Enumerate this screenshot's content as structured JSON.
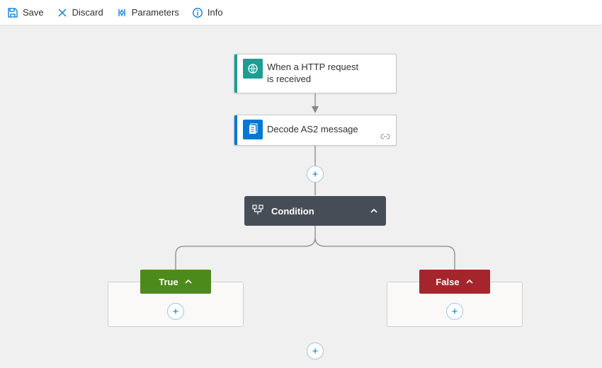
{
  "toolbar": {
    "save": "Save",
    "discard": "Discard",
    "parameters": "Parameters",
    "info": "Info"
  },
  "nodes": {
    "trigger": {
      "label": "When a HTTP request is received",
      "accent": "#1b9e94",
      "icon_bg": "#1b9e94"
    },
    "decode": {
      "label": "Decode AS2 message",
      "accent": "#0078d4",
      "icon_bg": "#0078d4"
    },
    "condition": {
      "label": "Condition"
    },
    "true_label": "True",
    "false_label": "False"
  },
  "glyphs": {
    "plus": "+"
  }
}
